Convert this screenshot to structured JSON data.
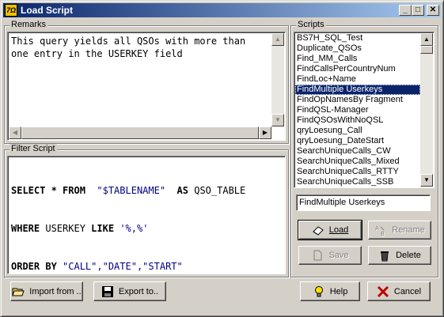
{
  "window": {
    "title": "Load Script",
    "app_icon_text": "7Ω"
  },
  "remarks": {
    "label": "Remarks",
    "lines": [
      "This query yields all QSOs with more than",
      "one entry in the USERKEY field"
    ]
  },
  "filter": {
    "label": "Filter Script",
    "line1": {
      "kw1": "SELECT * FROM",
      "str": "\"$TABLENAME\"",
      "kw2": "AS",
      "ident": "QSO_TABLE"
    },
    "line2": {
      "kw": "WHERE",
      "ident": "USERKEY",
      "kw2": "LIKE",
      "str": "'%,%'"
    },
    "line3": {
      "kw": "ORDER BY",
      "str": "\"CALL\",\"DATE\",\"START\""
    }
  },
  "scripts": {
    "label": "Scripts",
    "items": [
      "BS7H_SQL_Test",
      "Duplicate_QSOs",
      "Find_MM_Calls",
      "FindCallsPerCountryNum",
      "FindLoc+Name",
      "FindMultiple Userkeys",
      "FindOpNamesBy Fragment",
      "FindQSL-Manager",
      "FindQSOsWithNoQSL",
      "qryLoesung_Call",
      "qryLoesung_DateStart",
      "SearchUniqueCalls_CW",
      "SearchUniqueCalls_Mixed",
      "SearchUniqueCalls_RTTY",
      "SearchUniqueCalls_SSB"
    ],
    "selected_index": 5,
    "name_value": "FindMultiple Userkeys"
  },
  "buttons": {
    "load": "Load",
    "rename": "Rename",
    "save": "Save",
    "delete": "Delete",
    "import": "Import from ..",
    "export": "Export to..",
    "help": "Help",
    "cancel": "Cancel"
  },
  "colors": {
    "titlebar_start": "#0a246a",
    "titlebar_end": "#a6caf0",
    "selection": "#0a246a",
    "face": "#d4d0c8"
  }
}
